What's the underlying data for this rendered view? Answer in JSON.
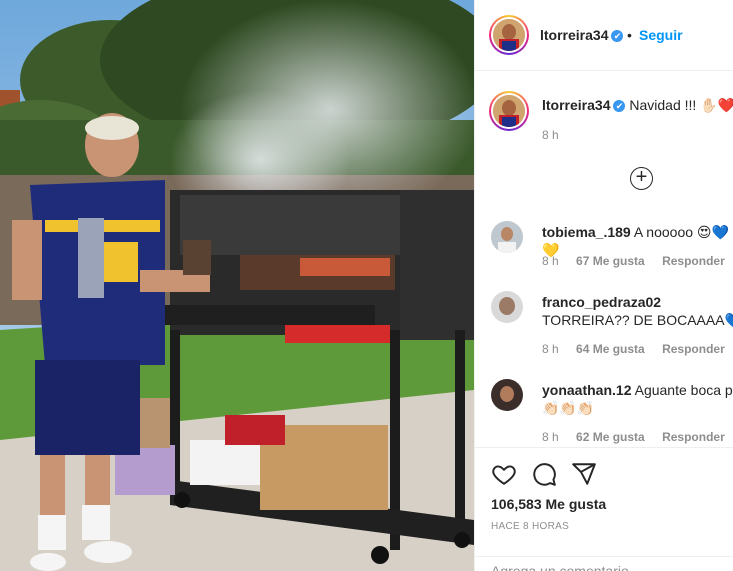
{
  "post": {
    "username": "ltorreira34",
    "verified_badge": "✔",
    "follow_label": "Seguir",
    "dot": "•",
    "caption": "Navidad !!! ✋🏻❤️",
    "caption_time": "8 h",
    "load_more_symbol": "+"
  },
  "comments": [
    {
      "username": "tobiema_.189",
      "text": "A nooooo 😍💙💛",
      "time": "8 h",
      "likes": "67 Me gusta",
      "reply": "Responder"
    },
    {
      "username": "franco_pedraza02",
      "text": "TORREIRA?? DE BOCAAAA💙",
      "time": "8 h",
      "likes": "64 Me gusta",
      "reply": "Responder"
    },
    {
      "username": "yonaathan.12",
      "text": "Aguante boca pa 👏🏻👏🏻👏🏻",
      "time": "8 h",
      "likes": "62 Me gusta",
      "reply": "Responder"
    }
  ],
  "actions": {
    "likes_count": "106,583",
    "likes_label": "Me gusta",
    "posted_ago": "HACE 8 HORAS",
    "comment_placeholder": "Agrega un comentario..."
  },
  "icons": [
    "heart-icon",
    "comment-icon",
    "share-icon",
    "verified-icon",
    "plus-circle-icon"
  ],
  "colors": {
    "link_blue": "#0095f6",
    "verified_blue": "#3897f0",
    "muted": "#8e8e8e"
  }
}
